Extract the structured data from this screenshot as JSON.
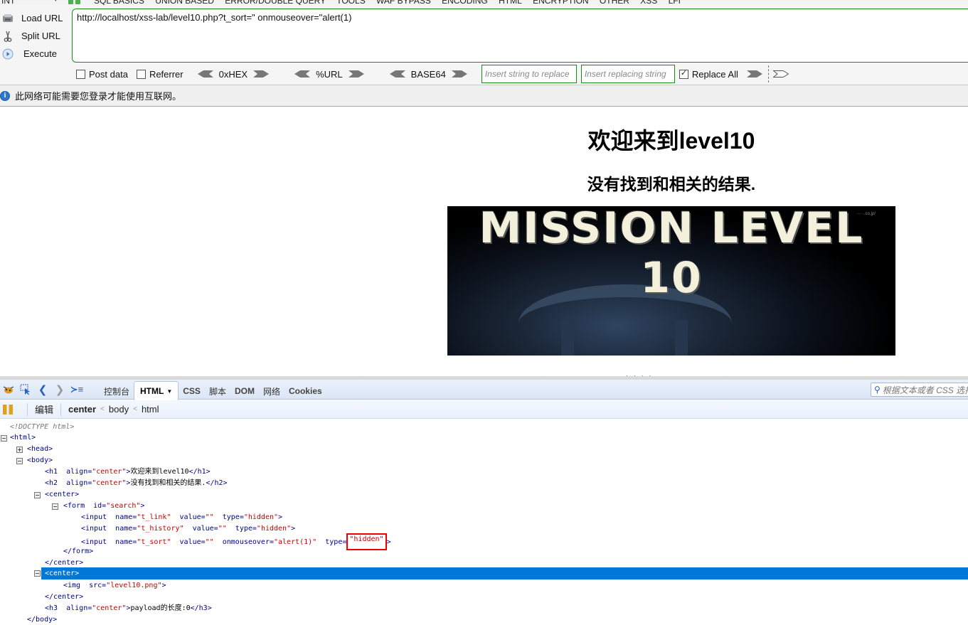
{
  "hackbar": {
    "menu": {
      "select_value": "INT",
      "items": [
        "SQL BASICS",
        "UNION BASED",
        "ERROR/DOUBLE QUERY",
        "TOOLS",
        "WAF BYPASS",
        "ENCODING",
        "HTML",
        "ENCRYPTION",
        "OTHER",
        "XSS",
        "LFI"
      ]
    },
    "buttons": {
      "load_url": "Load URL",
      "split_url": "Split URL",
      "execute": "Execute"
    },
    "url_value": "http://localhost/xss-lab/level10.php?t_sort=\" onmouseover=\"alert(1)",
    "options": {
      "post_data": {
        "label": "Post data",
        "checked": false
      },
      "referrer": {
        "label": "Referrer",
        "checked": false
      },
      "encoders": [
        "0xHEX",
        "%URL",
        "BASE64"
      ],
      "replace_from_placeholder": "Insert string to replace",
      "replace_to_placeholder": "Insert replacing string",
      "replace_all": {
        "label": "Replace All",
        "checked": true
      }
    }
  },
  "notice": {
    "text": "此网络可能需要您登录才能使用互联网。"
  },
  "page": {
    "h1": "欢迎来到level10",
    "h2": "没有找到和相关的结果.",
    "banner_title": "MISSION LEVEL 10",
    "h3_partial": "payload的长度:0"
  },
  "firebug": {
    "tabs": [
      {
        "label": "控制台",
        "active": false
      },
      {
        "label": "HTML",
        "active": true
      },
      {
        "label": "CSS",
        "active": false
      },
      {
        "label": "脚本",
        "active": false
      },
      {
        "label": "DOM",
        "active": false
      },
      {
        "label": "网络",
        "active": false
      },
      {
        "label": "Cookies",
        "active": false
      }
    ],
    "search_placeholder": "根据文本或者 CSS 选择器",
    "edit_label": "编辑",
    "breadcrumb": [
      "center",
      "body",
      "html"
    ],
    "tree": {
      "doctype": "<!DOCTYPE html>",
      "html_open": "<html>",
      "head": "<head>",
      "body_open": "<body>",
      "h1": {
        "tag": "h1",
        "attr": "align",
        "val": "center",
        "text": "欢迎来到level10"
      },
      "h2": {
        "tag": "h2",
        "attr": "align",
        "val": "center",
        "text": "没有找到和相关的结果."
      },
      "center_open": "<center>",
      "form": {
        "attr": "id",
        "val": "search"
      },
      "inputs": [
        {
          "name": "t_link",
          "value": "",
          "type": "hidden"
        },
        {
          "name": "t_history",
          "value": "",
          "type": "hidden"
        },
        {
          "name": "t_sort",
          "value": "",
          "onmouseover": "alert(1)",
          "type": "hidden"
        }
      ],
      "form_close": "</form>",
      "center_close": "</center>",
      "img_src": "level10.png",
      "h3": {
        "tag": "h3",
        "attr": "align",
        "val": "center",
        "text": "payload的长度:0"
      },
      "body_close": "</body>"
    }
  }
}
